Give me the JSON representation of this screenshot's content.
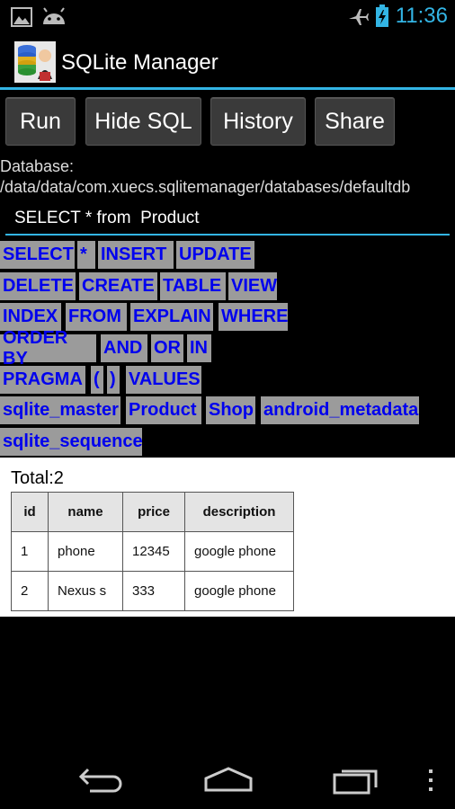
{
  "status_bar": {
    "time": "11:36",
    "icons": [
      "gallery-icon",
      "android-icon",
      "airplane-mode-icon",
      "battery-charging-icon"
    ]
  },
  "app": {
    "title": "SQLite Manager"
  },
  "toolbar": {
    "run": "Run",
    "hide_sql": "Hide SQL",
    "history": "History",
    "share": "Share"
  },
  "database": {
    "path": "Database: /data/data/com.xuecs.sqlitemanager/databases/defaultdb"
  },
  "sql": {
    "query": "SELECT * from  Product"
  },
  "keywords": [
    "SELECT",
    "*",
    "INSERT",
    "UPDATE",
    "DELETE",
    "CREATE",
    "TABLE",
    "VIEW",
    "INDEX",
    "FROM",
    "EXPLAIN",
    "WHERE",
    "ORDER BY",
    "AND",
    "OR",
    "IN",
    "PRAGMA",
    "(",
    ")",
    "VALUES",
    "sqlite_master",
    "Product",
    "Shop",
    "android_metadata",
    "sqlite_sequence"
  ],
  "results": {
    "total": "Total:2",
    "columns": [
      "id",
      "name",
      "price",
      "description"
    ],
    "rows": [
      [
        "1",
        "phone",
        "12345",
        "google phone"
      ],
      [
        "2",
        "Nexus s",
        "333",
        "google phone"
      ]
    ]
  },
  "colors": {
    "accent": "#33b5e5",
    "keyword_text": "#0000ee",
    "keyword_bg": "#9b9b9b"
  },
  "nav": {
    "icons": [
      "back-icon",
      "home-icon",
      "recent-apps-icon",
      "menu-overflow-icon"
    ]
  }
}
